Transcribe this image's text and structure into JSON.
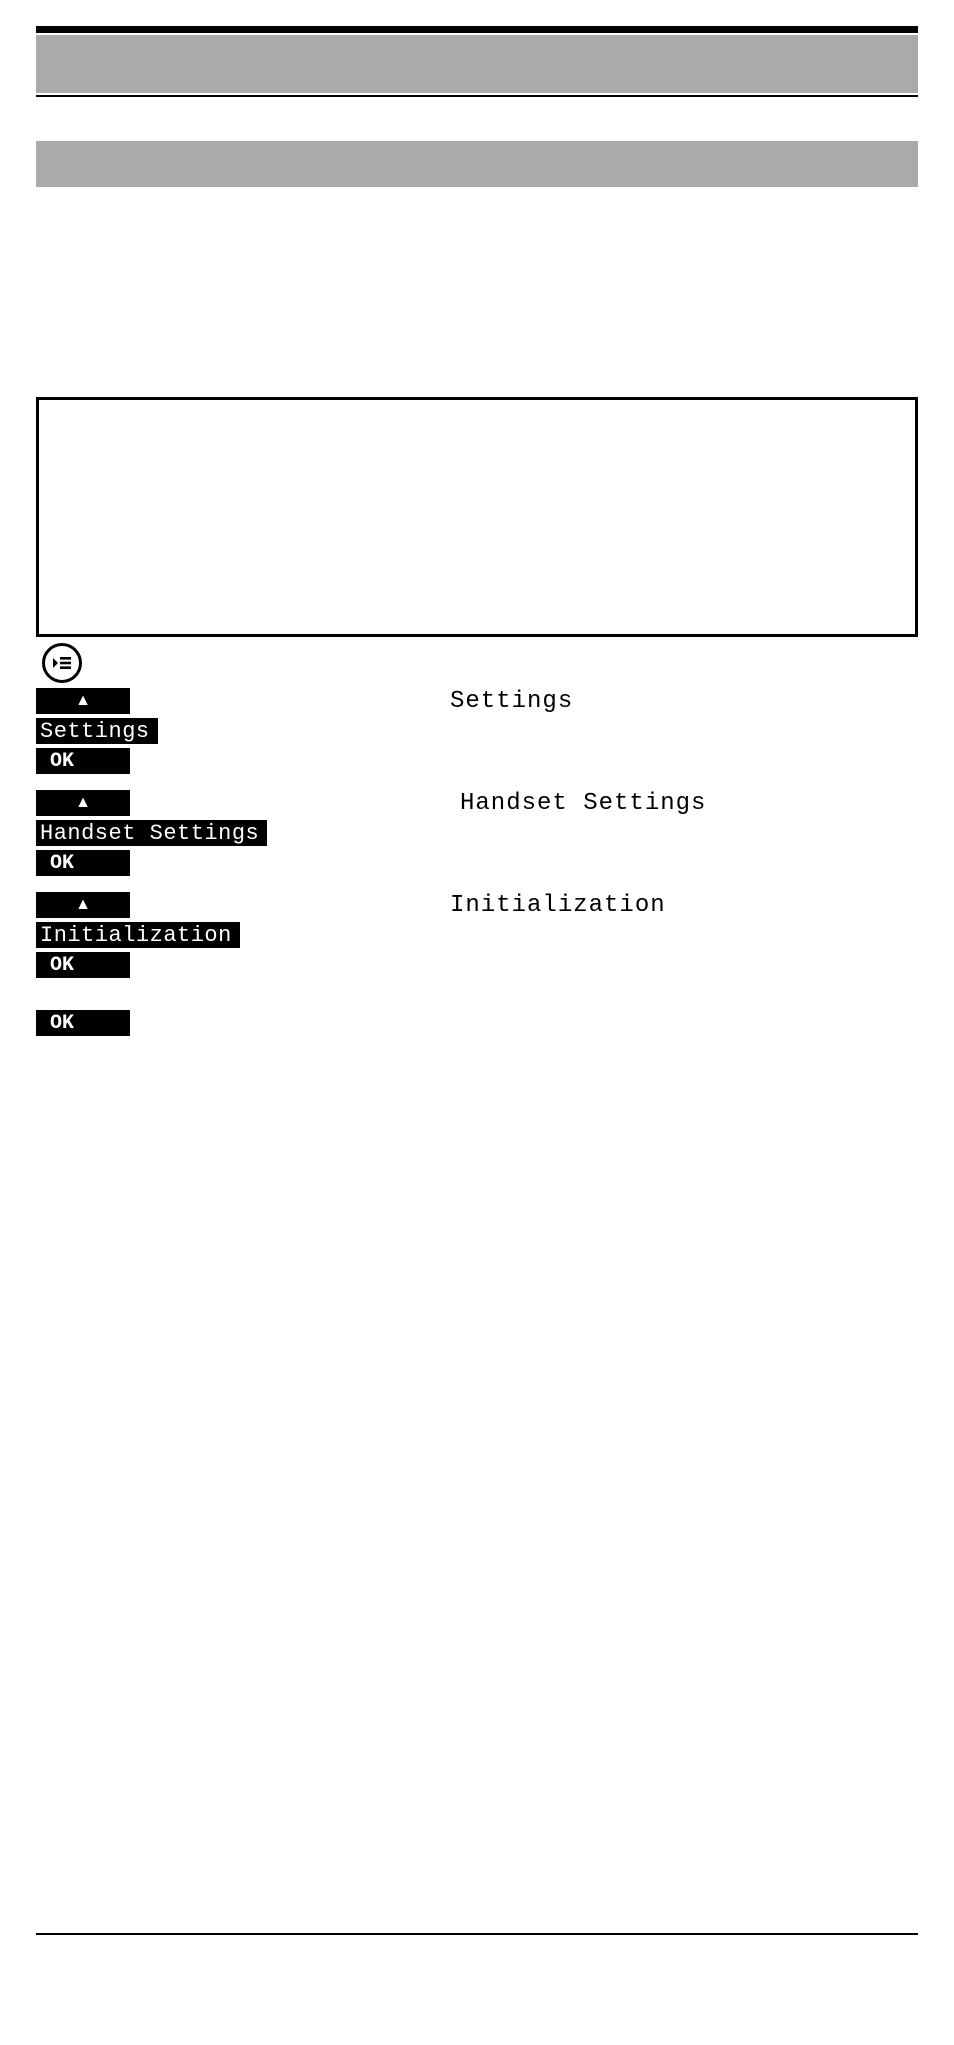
{
  "header": {
    "title": "",
    "subtitle": ""
  },
  "infobox": {
    "content": ""
  },
  "steps": [
    {
      "arrow_glyph": "▲",
      "menu_label_right": "Settings",
      "inverted_label": "Settings",
      "ok_label": "OK"
    },
    {
      "arrow_glyph": "▲",
      "menu_label_right": "Handset Settings",
      "inverted_label": "Handset Settings",
      "ok_label": "OK"
    },
    {
      "arrow_glyph": "▲",
      "menu_label_right": "Initialization",
      "inverted_label": "Initialization",
      "ok_label": "OK"
    }
  ],
  "final_ok": "OK",
  "icons": {
    "menu": "menu-icon"
  }
}
